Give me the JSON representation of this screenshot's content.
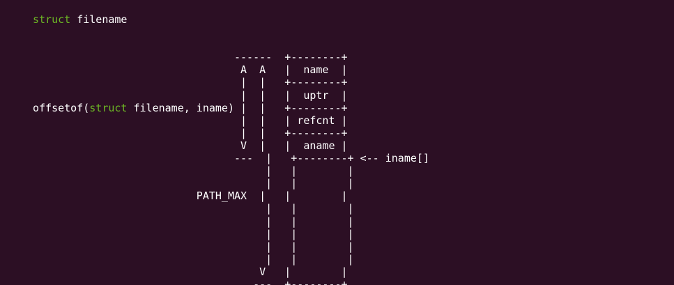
{
  "colors": {
    "background": "#2c0f24",
    "text": "#ffffff",
    "keyword": "#6cb624"
  },
  "code": {
    "title_keyword": "struct",
    "title_rest": " filename",
    "lines": [
      "",
      "",
      "                                ------  +--------+",
      "                                 A  A   |  name  |",
      "                                 |  |   +--------+",
      "                                 |  |   |  uptr  |",
      "                                 |  |   +--------+",
      "                                 |  |   | refcnt |",
      "                                 |  |   +--------+",
      "                                 V  |   |  aname |",
      "                                ---  |   +--------+ <-- iname[]",
      "                                     |   |        |",
      "                                     |   |        |",
      "                          PATH_MAX  |   |        |",
      "                                     |   |        |",
      "                                     |   |        |",
      "                                     |   |        |",
      "                                     |   |        |",
      "                                     |   |        |",
      "                                    V   |        |",
      "                                   ---  +--------+"
    ],
    "offsetof_prefix": "offsetof(",
    "offsetof_keyword": "struct",
    "offsetof_rest": " filename, iname) |  |   +--------+"
  }
}
